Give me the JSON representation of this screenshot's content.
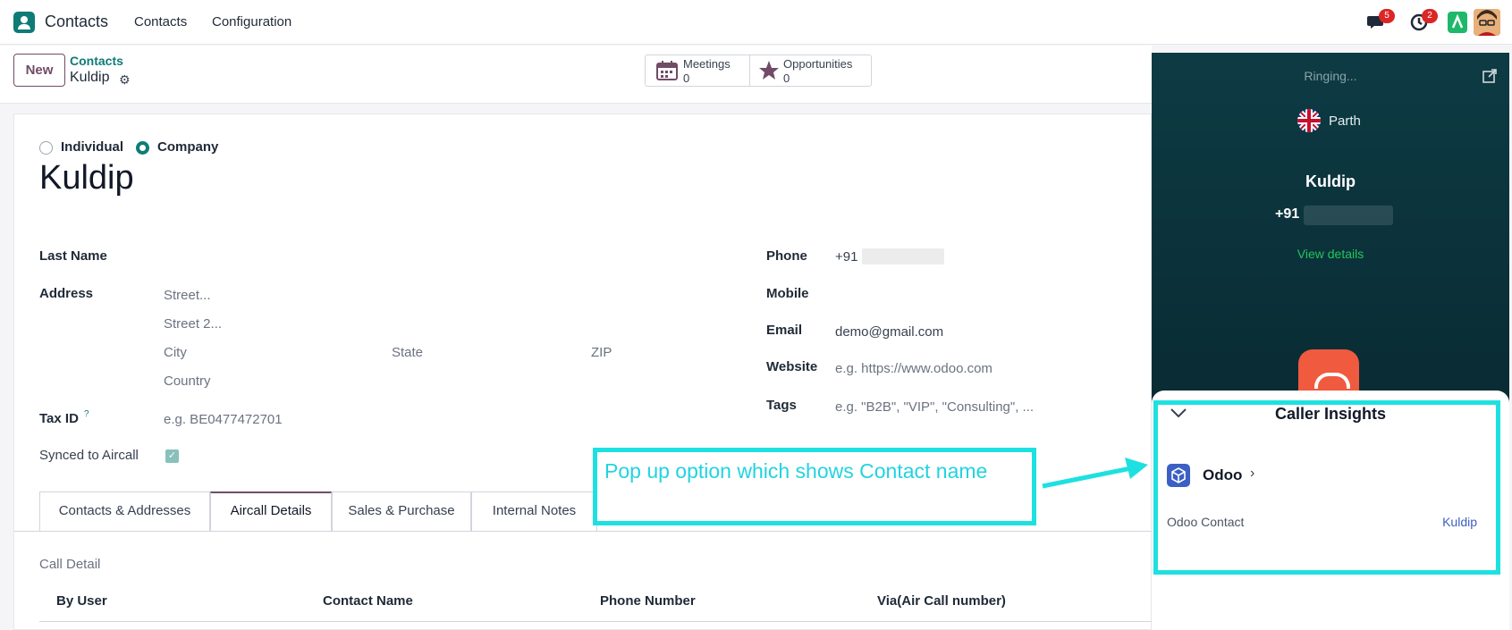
{
  "navbar": {
    "app_name": "Contacts",
    "menu": [
      "Contacts",
      "Configuration"
    ],
    "messages_badge": "5",
    "activities_badge": "2"
  },
  "control": {
    "new_label": "New",
    "breadcrumb": "Contacts",
    "record_name": "Kuldip",
    "smart_buttons": [
      {
        "label": "Meetings",
        "count": "0",
        "icon": "calendar-icon"
      },
      {
        "label": "Opportunities",
        "count": "0",
        "icon": "star-icon"
      }
    ]
  },
  "form": {
    "company_type": {
      "individual": "Individual",
      "company": "Company",
      "selected": "Company"
    },
    "name": "Kuldip",
    "last_name_label": "Last Name",
    "address_label": "Address",
    "street_ph": "Street...",
    "street2_ph": "Street 2...",
    "city_ph": "City",
    "state_ph": "State",
    "zip_ph": "ZIP",
    "country_ph": "Country",
    "taxid_label": "Tax ID",
    "taxid_help": "?",
    "taxid_ph": "e.g. BE0477472701",
    "synced_label": "Synced to Aircall",
    "synced_checked": true,
    "phone_label": "Phone",
    "phone_value": "+91",
    "mobile_label": "Mobile",
    "email_label": "Email",
    "email_value": "demo@gmail.com",
    "website_label": "Website",
    "website_ph": "e.g. https://www.odoo.com",
    "tags_label": "Tags",
    "tags_ph": "e.g. \"B2B\", \"VIP\", \"Consulting\", ..."
  },
  "tabs": [
    {
      "label": "Contacts & Addresses",
      "active": false
    },
    {
      "label": "Aircall Details",
      "active": true
    },
    {
      "label": "Sales & Purchase",
      "active": false
    },
    {
      "label": "Internal Notes",
      "active": false
    }
  ],
  "call_detail": {
    "section_label": "Call Detail",
    "columns": [
      "By User",
      "Contact Name",
      "Phone Number",
      "Via(Air Call number)"
    ]
  },
  "aircall": {
    "status": "Ringing...",
    "agent_name": "Parth",
    "caller_name": "Kuldip",
    "caller_number": "+91",
    "view_details": "View details",
    "insights": {
      "title": "Caller Insights",
      "integration": "Odoo",
      "contact_label": "Odoo Contact",
      "contact_value": "Kuldip"
    }
  },
  "annotation": {
    "text": "Pop up option which shows Contact name",
    "color": "#1fe0e0"
  },
  "colors": {
    "brand": "#714b67",
    "teal": "#0f7b75",
    "aircall_bg": "#0d3b44"
  }
}
